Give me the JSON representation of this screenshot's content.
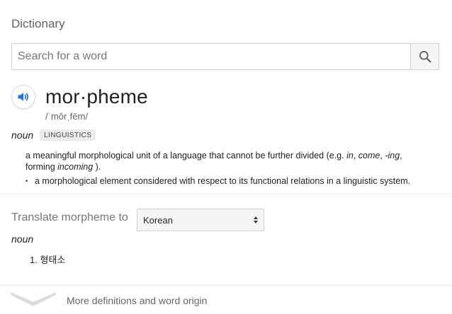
{
  "header": {
    "title": "Dictionary"
  },
  "search": {
    "placeholder": "Search for a word",
    "value": ""
  },
  "entry": {
    "word": "mor·pheme",
    "phonetic": "/ˈmôrˌfēm/",
    "part_of_speech": "noun",
    "domain_label": "LINGUISTICS",
    "definition": {
      "text_main": "a meaningful morphological unit of a language that cannot be further divided (e.g. ",
      "ex1": "in",
      "sep1": ", ",
      "ex2": "come",
      "sep2": ", ",
      "ex3": "-ing",
      "sep3": ", forming ",
      "ex4": "incoming",
      "end": " )."
    },
    "sub_definition": "a morphological element considered with respect to its functional relations in a linguistic system.",
    "bullet_symbol": "•"
  },
  "translate": {
    "label": "Translate morpheme to",
    "language": "Korean",
    "part_of_speech": "noun",
    "results": [
      "1. 형태소"
    ]
  },
  "footer": {
    "more_label": "More definitions and word origin"
  },
  "colors": {
    "accent": "#1a73e8",
    "muted": "#5f6368",
    "border": "#d0d0d0"
  },
  "icons": {
    "search": "search-icon",
    "speaker": "speaker-icon",
    "expand": "chevron-down-icon"
  }
}
